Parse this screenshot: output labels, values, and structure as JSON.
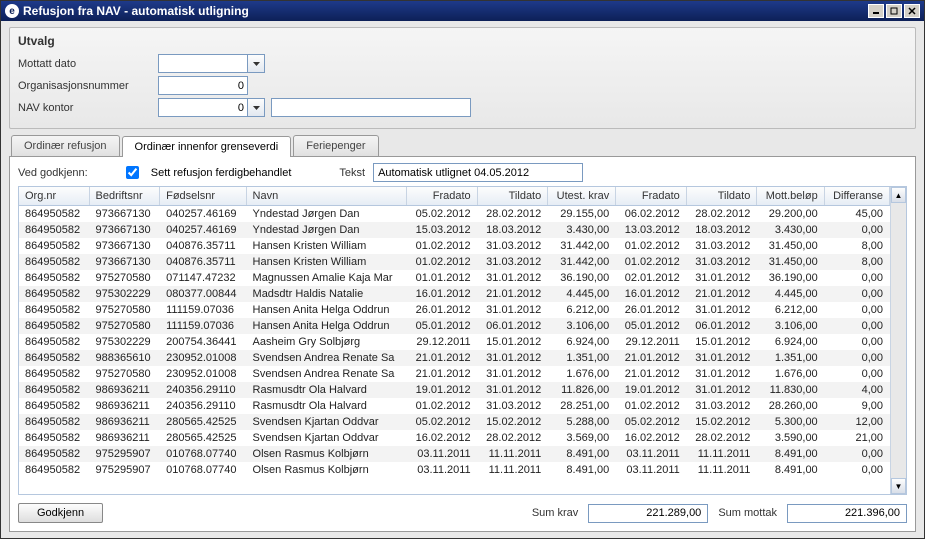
{
  "window": {
    "title": "Refusjon fra NAV - automatisk utligning"
  },
  "utvalg": {
    "legend": "Utvalg",
    "mottatt_label": "Mottatt dato",
    "mottatt_value": "",
    "orgnr_label": "Organisasjonsnummer",
    "orgnr_value": "0",
    "navkontor_label": "NAV kontor",
    "navkontor_value": "0",
    "navkontor_text": ""
  },
  "tabs": {
    "t0": "Ordinær refusjon",
    "t1": "Ordinær innenfor grenseverdi",
    "t2": "Feriepenger"
  },
  "panel": {
    "ved_godkjenn": "Ved godkjenn:",
    "chk_label": "Sett refusjon ferdigbehandlet",
    "tekst_label": "Tekst",
    "tekst_value": "Automatisk utlignet 04.05.2012"
  },
  "columns": {
    "c0": "Org.nr",
    "c1": "Bedriftsnr",
    "c2": "Fødselsnr",
    "c3": "Navn",
    "c4": "Fradato",
    "c5": "Tildato",
    "c6": "Utest. krav",
    "c7": "Fradato",
    "c8": "Tildato",
    "c9": "Mott.beløp",
    "c10": "Differanse"
  },
  "rows": [
    {
      "c0": "864950582",
      "c1": "973667130",
      "c2": "040257.46169",
      "c3": "Yndestad Jørgen Dan",
      "c4": "05.02.2012",
      "c5": "28.02.2012",
      "c6": "29.155,00",
      "c7": "06.02.2012",
      "c8": "28.02.2012",
      "c9": "29.200,00",
      "c10": "45,00"
    },
    {
      "c0": "864950582",
      "c1": "973667130",
      "c2": "040257.46169",
      "c3": "Yndestad Jørgen Dan",
      "c4": "15.03.2012",
      "c5": "18.03.2012",
      "c6": "3.430,00",
      "c7": "13.03.2012",
      "c8": "18.03.2012",
      "c9": "3.430,00",
      "c10": "0,00"
    },
    {
      "c0": "864950582",
      "c1": "973667130",
      "c2": "040876.35711",
      "c3": "Hansen Kristen William",
      "c4": "01.02.2012",
      "c5": "31.03.2012",
      "c6": "31.442,00",
      "c7": "01.02.2012",
      "c8": "31.03.2012",
      "c9": "31.450,00",
      "c10": "8,00"
    },
    {
      "c0": "864950582",
      "c1": "973667130",
      "c2": "040876.35711",
      "c3": "Hansen Kristen William",
      "c4": "01.02.2012",
      "c5": "31.03.2012",
      "c6": "31.442,00",
      "c7": "01.02.2012",
      "c8": "31.03.2012",
      "c9": "31.450,00",
      "c10": "8,00"
    },
    {
      "c0": "864950582",
      "c1": "975270580",
      "c2": "071147.47232",
      "c3": "Magnussen Amalie Kaja Mar",
      "c4": "01.01.2012",
      "c5": "31.01.2012",
      "c6": "36.190,00",
      "c7": "02.01.2012",
      "c8": "31.01.2012",
      "c9": "36.190,00",
      "c10": "0,00"
    },
    {
      "c0": "864950582",
      "c1": "975302229",
      "c2": "080377.00844",
      "c3": "Madsdtr Haldis Natalie",
      "c4": "16.01.2012",
      "c5": "21.01.2012",
      "c6": "4.445,00",
      "c7": "16.01.2012",
      "c8": "21.01.2012",
      "c9": "4.445,00",
      "c10": "0,00"
    },
    {
      "c0": "864950582",
      "c1": "975270580",
      "c2": "111159.07036",
      "c3": "Hansen Anita Helga Oddrun",
      "c4": "26.01.2012",
      "c5": "31.01.2012",
      "c6": "6.212,00",
      "c7": "26.01.2012",
      "c8": "31.01.2012",
      "c9": "6.212,00",
      "c10": "0,00"
    },
    {
      "c0": "864950582",
      "c1": "975270580",
      "c2": "111159.07036",
      "c3": "Hansen Anita Helga Oddrun",
      "c4": "05.01.2012",
      "c5": "06.01.2012",
      "c6": "3.106,00",
      "c7": "05.01.2012",
      "c8": "06.01.2012",
      "c9": "3.106,00",
      "c10": "0,00"
    },
    {
      "c0": "864950582",
      "c1": "975302229",
      "c2": "200754.36441",
      "c3": "Aasheim Gry Solbjørg",
      "c4": "29.12.2011",
      "c5": "15.01.2012",
      "c6": "6.924,00",
      "c7": "29.12.2011",
      "c8": "15.01.2012",
      "c9": "6.924,00",
      "c10": "0,00"
    },
    {
      "c0": "864950582",
      "c1": "988365610",
      "c2": "230952.01008",
      "c3": "Svendsen Andrea Renate Sa",
      "c4": "21.01.2012",
      "c5": "31.01.2012",
      "c6": "1.351,00",
      "c7": "21.01.2012",
      "c8": "31.01.2012",
      "c9": "1.351,00",
      "c10": "0,00"
    },
    {
      "c0": "864950582",
      "c1": "975270580",
      "c2": "230952.01008",
      "c3": "Svendsen Andrea Renate Sa",
      "c4": "21.01.2012",
      "c5": "31.01.2012",
      "c6": "1.676,00",
      "c7": "21.01.2012",
      "c8": "31.01.2012",
      "c9": "1.676,00",
      "c10": "0,00"
    },
    {
      "c0": "864950582",
      "c1": "986936211",
      "c2": "240356.29110",
      "c3": "Rasmusdtr Ola Halvard",
      "c4": "19.01.2012",
      "c5": "31.01.2012",
      "c6": "11.826,00",
      "c7": "19.01.2012",
      "c8": "31.01.2012",
      "c9": "11.830,00",
      "c10": "4,00"
    },
    {
      "c0": "864950582",
      "c1": "986936211",
      "c2": "240356.29110",
      "c3": "Rasmusdtr Ola Halvard",
      "c4": "01.02.2012",
      "c5": "31.03.2012",
      "c6": "28.251,00",
      "c7": "01.02.2012",
      "c8": "31.03.2012",
      "c9": "28.260,00",
      "c10": "9,00"
    },
    {
      "c0": "864950582",
      "c1": "986936211",
      "c2": "280565.42525",
      "c3": "Svendsen Kjartan Oddvar",
      "c4": "05.02.2012",
      "c5": "15.02.2012",
      "c6": "5.288,00",
      "c7": "05.02.2012",
      "c8": "15.02.2012",
      "c9": "5.300,00",
      "c10": "12,00"
    },
    {
      "c0": "864950582",
      "c1": "986936211",
      "c2": "280565.42525",
      "c3": "Svendsen Kjartan Oddvar",
      "c4": "16.02.2012",
      "c5": "28.02.2012",
      "c6": "3.569,00",
      "c7": "16.02.2012",
      "c8": "28.02.2012",
      "c9": "3.590,00",
      "c10": "21,00"
    },
    {
      "c0": "864950582",
      "c1": "975295907",
      "c2": "010768.07740",
      "c3": "Olsen Rasmus Kolbjørn",
      "c4": "03.11.2011",
      "c5": "11.11.2011",
      "c6": "8.491,00",
      "c7": "03.11.2011",
      "c8": "11.11.2011",
      "c9": "8.491,00",
      "c10": "0,00"
    },
    {
      "c0": "864950582",
      "c1": "975295907",
      "c2": "010768.07740",
      "c3": "Olsen Rasmus Kolbjørn",
      "c4": "03.11.2011",
      "c5": "11.11.2011",
      "c6": "8.491,00",
      "c7": "03.11.2011",
      "c8": "11.11.2011",
      "c9": "8.491,00",
      "c10": "0,00"
    }
  ],
  "footer": {
    "godkjenn": "Godkjenn",
    "sum_krav_label": "Sum krav",
    "sum_krav_value": "221.289,00",
    "sum_mottak_label": "Sum mottak",
    "sum_mottak_value": "221.396,00"
  }
}
